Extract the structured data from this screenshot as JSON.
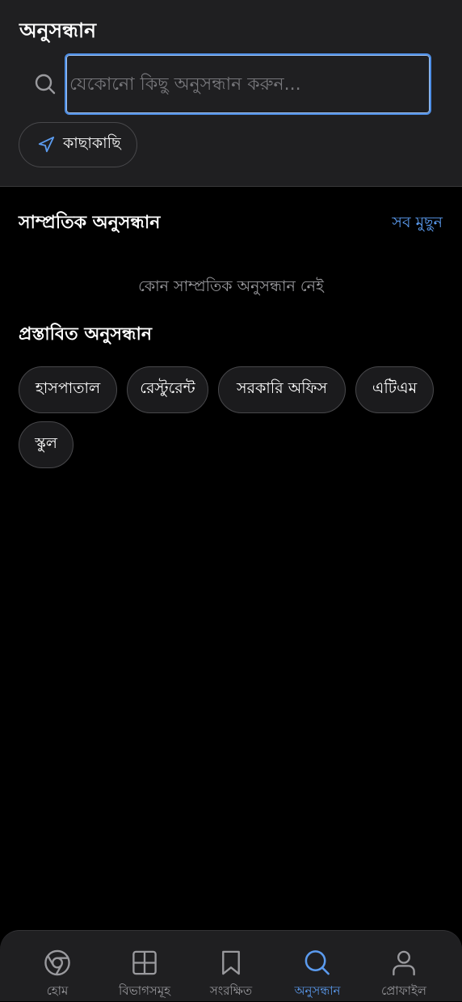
{
  "header": {
    "title": "অনুসন্ধান",
    "search_placeholder": "যেকোনো কিছু অনুসন্ধান করুন...",
    "search_value": "",
    "nearby_label": "কাছাকাছি"
  },
  "recent": {
    "title": "সাম্প্রতিক অনুসন্ধান",
    "clear_all": "সব মুছুন",
    "empty_text": "কোন সাম্প্রতিক অনুসন্ধান নেই"
  },
  "suggested": {
    "title": "প্রস্তাবিত অনুসন্ধান",
    "items": [
      "হাসপাতাল",
      "রেস্টুরেন্ট",
      "সরকারি অফিস",
      "এটিএম",
      "স্কুল"
    ]
  },
  "nav": {
    "items": [
      {
        "label": "হোম",
        "icon": "chrome-icon"
      },
      {
        "label": "বিভাগসমূহ",
        "icon": "grid-icon"
      },
      {
        "label": "সংরক্ষিত",
        "icon": "bookmark-icon"
      },
      {
        "label": "অনুসন্ধান",
        "icon": "search-icon"
      },
      {
        "label": "প্রোফাইল",
        "icon": "user-icon"
      }
    ],
    "active": "অনুসন্ধান"
  },
  "colors": {
    "accent": "#5b9bef",
    "header_bg": "#1f1f21",
    "page_bg": "#000000",
    "muted_text": "#9a9a9e"
  }
}
